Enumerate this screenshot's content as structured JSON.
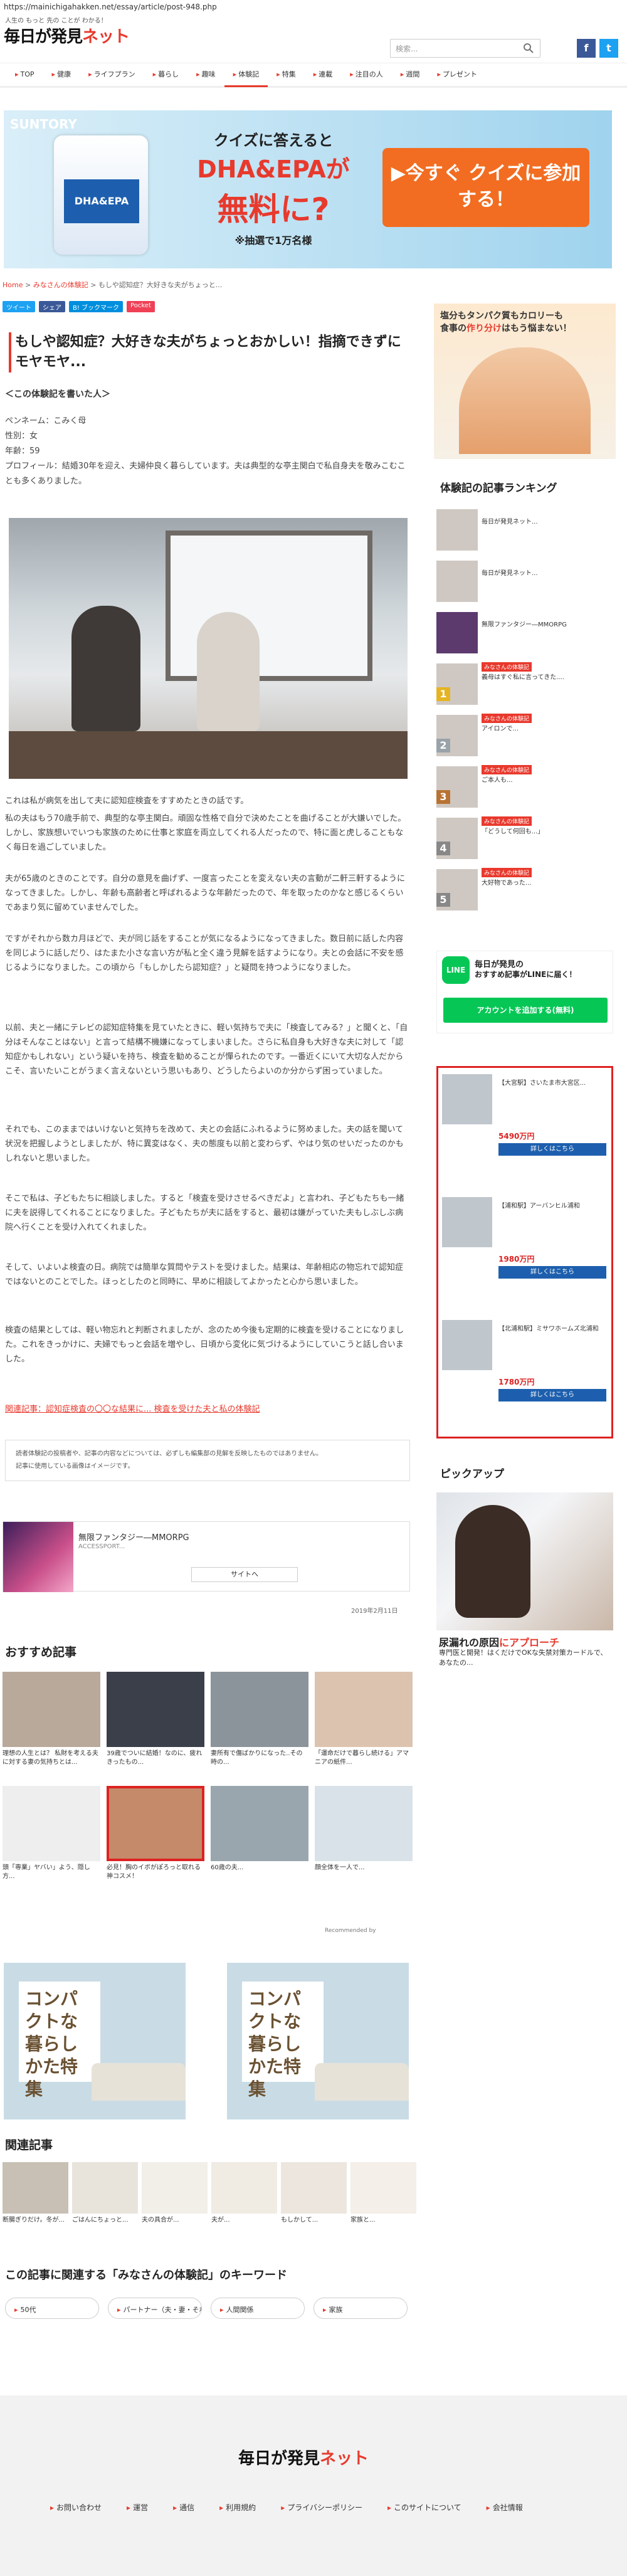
{
  "browser": {
    "url": "https://mainichigahakken.net/essay/article/post-948.php"
  },
  "header": {
    "tagline": "人生の もっと 先の ことが わかる！",
    "logo_main": "毎日が発見",
    "logo_accent": "ネット",
    "search_placeholder": "検索...",
    "social": [
      "f",
      "t"
    ]
  },
  "nav": [
    "TOP",
    "健康",
    "ライフプラン",
    "暮らし",
    "趣味",
    "体験記",
    "特集",
    "連載",
    "注目の人",
    "週間",
    "プレゼント"
  ],
  "ad_top": {
    "brand": "SUNTORY",
    "bottle_label": "DHA&EPA",
    "line1": "クイズに答えると",
    "line2": "DHA&EPAが",
    "line3": "無料に?",
    "line4": "※抽選で1万名様",
    "cta": "▶今すぐ クイズに参加する！"
  },
  "breadcrumb": {
    "home": "Home",
    "sep": " > ",
    "cat": "みなさんの体験記",
    "current": "もしや認知症？大好きな夫がちょっと..."
  },
  "share": [
    "ツイート",
    "シェア",
    "B! ブックマーク",
    "Pocket"
  ],
  "article": {
    "title": "もしや認知症？大好きな夫がちょっとおかしい！指摘できずにモヤモヤ...",
    "subhead": "＜この体験記を書いた人＞",
    "profile": [
      "ペンネーム：こみく母",
      "性別：女",
      "年齢：59",
      "プロフィール：結婚30年を迎え、夫婦仲良く暮らしています。夫は典型的な亭主関白で私自身夫を敬みこむことも多くありました。"
    ],
    "paragraphs": [
      "これは私が病気を出して夫に認知症検査をすすめたときの話です。",
      "私の夫はもう70歳手前で、典型的な亭主関白。頑固な性格で自分で決めたことを曲げることが大嫌いでした。しかし、家族想いでいつも家族のために仕事と家庭を両立してくれる人だったので、特に面と虎しることもなく毎日を過ごしていました。",
      "夫が65歳のときのことです。自分の意見を曲げず、一度言ったことを変えない夫の言動が二軒三軒するようになってきました。しかし、年齢も高齢者と呼ばれるような年齢だったので、年を取ったのかなと感じるくらいであまり気に留めていませんでした。",
      "ですがそれから数カ月ほどで、夫が同じ話をすることが気になるようになってきました。数日前に話した内容を同じように話しだり、はたまた小さな言い方が私と全く違う見解を話すようになり。夫との会話に不安を感じるようになりました。この頃から「もしかしたら認知症？」と疑問を持つようになりました。",
      "以前、夫と一緒にテレビの認知症特集を見ていたときに、軽い気持ちで夫に「検査してみる？」と聞くと、「自分はそんなことはない」と言って結構不機嫌になってしまいました。さらに私自身も大好きな夫に対して「認知症かもしれない」という疑いを持ち、検査を勧めることが憚られたのです。一番近くにいて大切な人だからこそ、言いたいことがうまく言えないという思いもあり、どうしたらよいのか分からず困っていました。",
      "それでも、このままではいけないと気持ちを改めて、夫との会話にふれるように努めました。夫の話を聞いて状況を把握しようとしましたが、特に異変はなく、夫の態度も以前と変わらず、やはり気のせいだったのかもしれないと思いました。",
      "そこで私は、子どもたちに相談しました。すると「検査を受けさせるべきだよ」と言われ、子どもたちも一緒に夫を説得してくれることになりました。子どもたちが夫に話をすると、最初は嫌がっていた夫もしぶしぶ病院へ行くことを受け入れてくれました。",
      "そして、いよいよ検査の日。病院では簡単な質問やテストを受けました。結果は、年齢相応の物忘れで認知症ではないとのことでした。ほっとしたのと同時に、早めに相談してよかったと心から思いました。",
      "検査の結果としては、軽い物忘れと判断されましたが、念のため今後も定期的に検査を受けることになりました。これをきっかけに、夫婦でもっと会話を増やし、日頃から変化に気づけるようにしていこうと話し合いました。"
    ],
    "related_link": "関連記事：認知症検査の〇〇な結果に... 検査を受けた夫と私の体験記",
    "notes": [
      "読者体験記の投稿者や、記事の内容などについては、必ずしも編集部の見解を反映したものではありません。",
      "記事に使用している画像はイメージです。"
    ],
    "date": "2019年2月11日"
  },
  "inline_ad": {
    "title": "無限ファンタジー―MMORPG",
    "sub": "ACCESSPORT...",
    "btn": "サイトへ"
  },
  "recommended": {
    "title": "おすすめ記事",
    "items": [
      "理想の人生とは？ 私財を考える夫に対する妻の気持ちとは...",
      "39歳でついに結婚！なのに、疲れきったもの...",
      "妻所有で傷ばかりになった..その時の...",
      "「運命だけで暮らし続ける」アマニアの紙件...",
      "頭「専業」ヤバい」よう、隠し方...",
      "必見！胸のイボがぽろっと取れる神コスメ！",
      "60歳の夫...",
      "顔全体を一人で..."
    ],
    "recommended_by": "Recommended by"
  },
  "square_ads": [
    {
      "title": "コンパクトな暮らしかた特集"
    },
    {
      "title": "コンパクトな暮らしかた特集"
    }
  ],
  "related": {
    "title": "関連記事",
    "items": [
      "断腸ぎりだけ。冬が...",
      "ごはんにちょっと...",
      "夫の具合が...",
      "夫が...",
      "もしかして...",
      "家族と..."
    ]
  },
  "keywords": {
    "title": "この記事に関連する「みなさんの体験記」のキーワード",
    "items": [
      "50代",
      "パートナー（夫・妻・それ以外）",
      "人間関係",
      "家族"
    ]
  },
  "sidebar": {
    "top_ad": {
      "text1": "塩分もタンパク質もカロリーも",
      "text2": "食事の",
      "red": "作り分け",
      "text3": "はもう悩まない！"
    },
    "ranking_title": "体験記の記事ランキング",
    "ranking": [
      {
        "tag": "",
        "title": "毎日が発見ネット...",
        "num": ""
      },
      {
        "tag": "",
        "title": "毎日が発見ネット...",
        "num": ""
      },
      {
        "tag": "",
        "title": "無限ファンタジー―MMORPG",
        "num": ""
      },
      {
        "tag": "みなさんの体験記",
        "title": "義母はすぐ私に言ってきた....",
        "num": "1"
      },
      {
        "tag": "みなさんの体験記",
        "title": "アイロンで...",
        "num": "2"
      },
      {
        "tag": "みなさんの体験記",
        "title": "ご本人も...",
        "num": "3"
      },
      {
        "tag": "みなさんの体験記",
        "title": "「どうして何回も...」",
        "num": "4"
      },
      {
        "tag": "みなさんの体験記",
        "title": "大好物であった...",
        "num": "5"
      }
    ],
    "line": {
      "icon": "LINE",
      "t1": "毎日が発見の",
      "t2": "おすすめ記事がLINEに届く！",
      "btn": "アカウントを追加する(無料)"
    },
    "realestate": [
      {
        "cap": "【大宮駅】さいたま市大宮区...",
        "price": "5490万円",
        "btn": "詳しくはこちら"
      },
      {
        "cap": "【浦和駅】アーバンヒル浦和",
        "price": "1980万円",
        "btn": "詳しくはこちら"
      },
      {
        "cap": "【北浦和駅】ミサワホームズ北浦和",
        "price": "1780万円",
        "btn": "詳しくはこちら"
      }
    ],
    "pickup_title": "ピックアップ",
    "pickup_headline_a": "尿漏れの原因",
    "pickup_headline_b": "にアプローチ",
    "pickup_desc": "専門医と開発！はくだけでOKな失禁対策カードルで、あなたの..."
  },
  "footer": {
    "logo_main": "毎日が発見",
    "logo_accent": "ネット",
    "links": [
      "お問い合わせ",
      "運営",
      "通信",
      "利用規約",
      "プライバシーポリシー",
      "このサイトについて",
      "会社情報"
    ]
  }
}
